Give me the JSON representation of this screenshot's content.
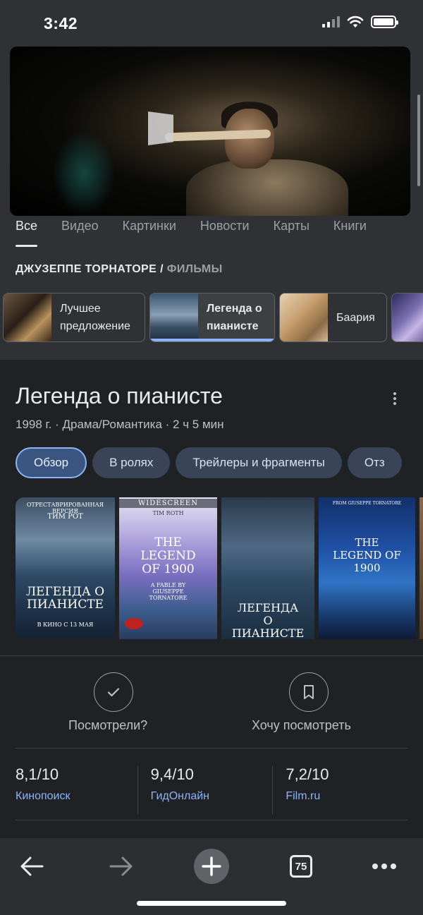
{
  "status_bar": {
    "time": "3:42"
  },
  "search_tabs": [
    "Все",
    "Видео",
    "Картинки",
    "Новости",
    "Карты",
    "Книги"
  ],
  "breadcrumb": {
    "primary": "ДЖУЗЕППЕ ТОРНАТОРЕ",
    "separator": "/",
    "secondary": "ФИЛЬМЫ"
  },
  "film_chips": [
    {
      "label": "Лучшее предложение",
      "selected": false
    },
    {
      "label": "Легенда о пианисте",
      "selected": true
    },
    {
      "label": "Баария",
      "selected": false
    }
  ],
  "movie": {
    "title": "Легенда о пианисте",
    "meta": "1998 г. · Драма/Романтика · 2 ч 5 мин"
  },
  "section_pills": [
    "Обзор",
    "В ролях",
    "Трейлеры и фрагменты",
    "Отз"
  ],
  "posters": [
    {
      "top": "ОТРЕСТАВРИРОВАННАЯ ВЕРСИЯ",
      "actor": "ТИМ РОТ",
      "title": "ЛЕГЕНДА О ПИАНИСТЕ",
      "bottom": "В КИНО С 13 МАЯ"
    },
    {
      "top": "WIDESCREEN",
      "actor": "TIM ROTH",
      "title": "THE LEGEND OF 1900",
      "bottom": "A FABLE BY GIUSEPPE TORNATORE"
    },
    {
      "top": "",
      "actor": "",
      "title": "ЛЕГЕНДА О ПИАНИСТЕ",
      "bottom": ""
    },
    {
      "top": "FROM GIUSEPPE TORNATORE",
      "actor": "",
      "title": "THE LEGEND OF 1900",
      "bottom": ""
    }
  ],
  "actions": {
    "watched": "Посмотрели?",
    "want": "Хочу посмотреть"
  },
  "ratings": [
    {
      "score": "8,1/10",
      "source": "Кинопоиск"
    },
    {
      "score": "9,4/10",
      "source": "ГидОнлайн"
    },
    {
      "score": "7,2/10",
      "source": "Film.ru"
    }
  ],
  "toolbar": {
    "tab_count": "75"
  },
  "colors": {
    "accent": "#8ab4f8",
    "background": "#202124",
    "surface": "#303134",
    "pill": "#394457"
  }
}
